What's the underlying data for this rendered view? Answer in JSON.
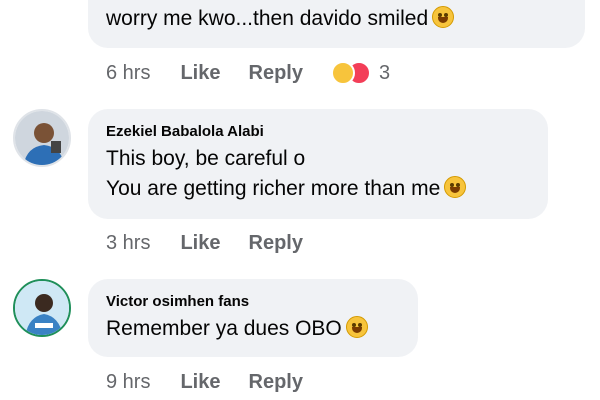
{
  "comments": [
    {
      "author": "",
      "lines": [
        "worry me kwo...then davido smiled"
      ],
      "line_emoji": [
        "grinning-face-emoji"
      ],
      "time": "6 hrs",
      "like_label": "Like",
      "reply_label": "Reply",
      "reaction_icons": [
        "haha-reaction-icon",
        "love-reaction-icon"
      ],
      "reaction_count": "3"
    },
    {
      "author": "Ezekiel Babalola Alabi",
      "lines": [
        "This boy, be careful o",
        "You are getting richer more than me"
      ],
      "line_emoji": [
        "",
        "laughing-tears-emoji"
      ],
      "time": "3 hrs",
      "like_label": "Like",
      "reply_label": "Reply"
    },
    {
      "author": "Victor osimhen fans",
      "lines": [
        "Remember ya dues OBO"
      ],
      "line_emoji": [
        "tears-of-joy-emoji"
      ],
      "time": "9 hrs",
      "like_label": "Like",
      "reply_label": "Reply"
    }
  ],
  "colors": {
    "bubble": "#f0f2f5",
    "meta_text": "#65676b",
    "text": "#050505"
  }
}
